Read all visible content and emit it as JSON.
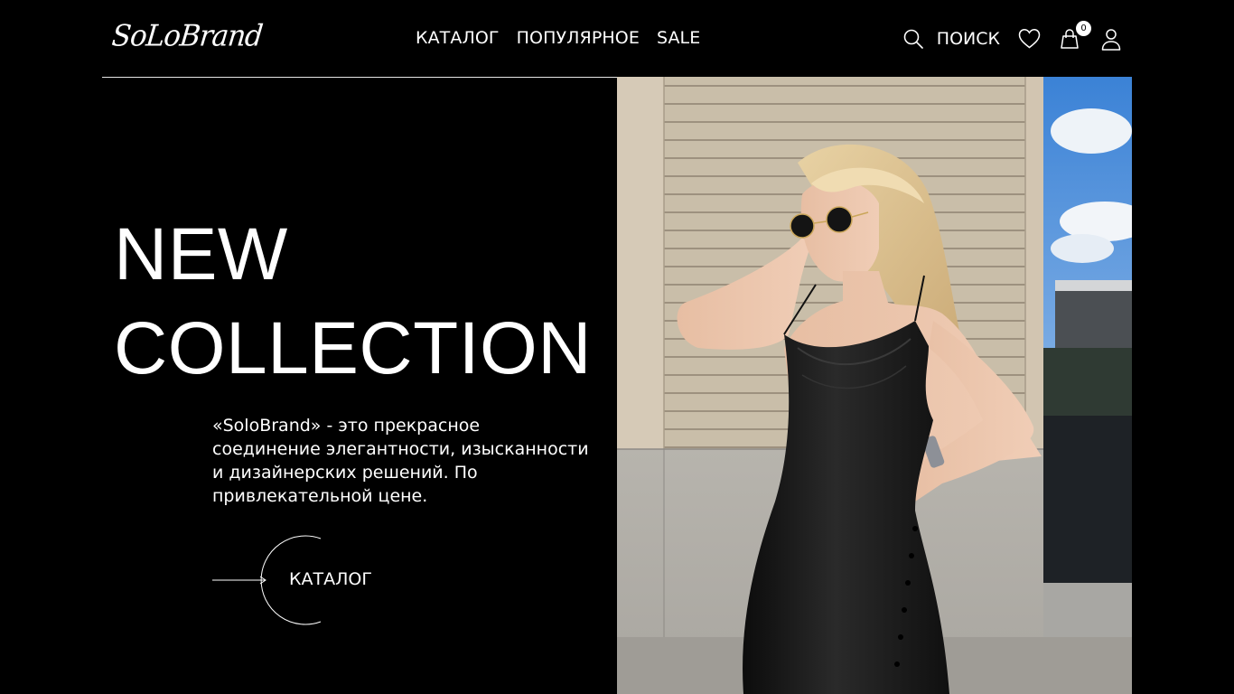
{
  "header": {
    "logo": "SoLoBrand",
    "nav": [
      "КАТАЛОГ",
      "ПОПУЛЯРНОЕ",
      "SALE"
    ],
    "search_label": "ПОИСК",
    "cart_count": "0"
  },
  "hero": {
    "title_line1": "NEW",
    "title_line2": "COLLECTION",
    "description": "«SoloBrand» - это прекрасное соединение элегантности, изысканности и дизайнерских решений. По привлекательной цене.",
    "cta_label": "КАТАЛОГ"
  },
  "icons": [
    "search-icon",
    "heart-icon",
    "shopping-bag-icon",
    "user-icon",
    "arrow-right-icon"
  ],
  "colors": {
    "background": "#000000",
    "text": "#ffffff"
  }
}
